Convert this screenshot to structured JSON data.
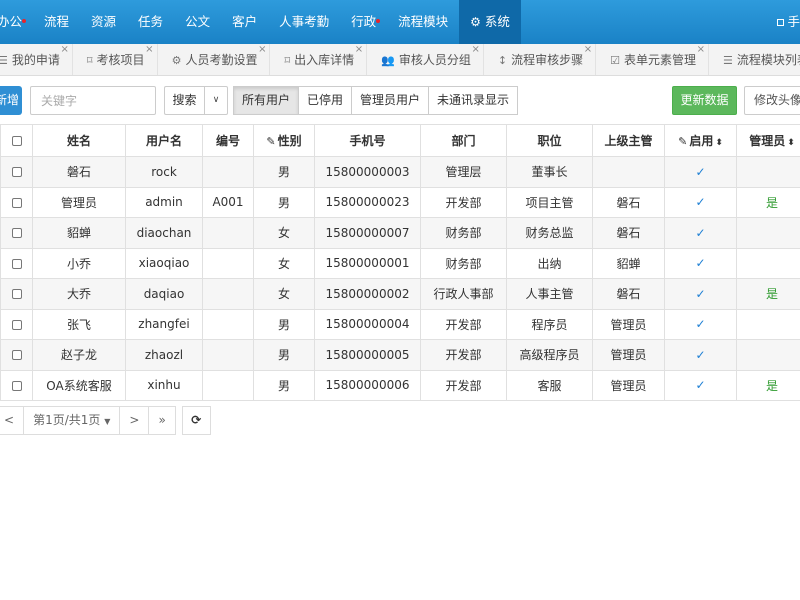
{
  "topnav": {
    "items": [
      {
        "label": "办公",
        "badge": true
      },
      {
        "label": "流程",
        "badge": false
      },
      {
        "label": "资源",
        "badge": false
      },
      {
        "label": "任务",
        "badge": false
      },
      {
        "label": "公文",
        "badge": false
      },
      {
        "label": "客户",
        "badge": false
      },
      {
        "label": "人事考勤",
        "badge": false
      },
      {
        "label": "行政",
        "badge": true
      },
      {
        "label": "流程模块",
        "badge": false
      }
    ],
    "active_label": "系统",
    "right_label": "手"
  },
  "tabs": [
    {
      "label": "我的申请",
      "icon": "list-icon"
    },
    {
      "label": "考核项目",
      "icon": "bookmark-icon"
    },
    {
      "label": "人员考勤设置",
      "icon": "gear-icon"
    },
    {
      "label": "出入库详情",
      "icon": "bookmark-icon"
    },
    {
      "label": "审核人员分组",
      "icon": "users-icon"
    },
    {
      "label": "流程审核步骤",
      "icon": "step-icon"
    },
    {
      "label": "表单元素管理",
      "icon": "checkbox-icon"
    },
    {
      "label": "流程模块列表",
      "icon": "list-icon"
    }
  ],
  "toolbar": {
    "add_label": "新增",
    "keyword_placeholder": "关键字",
    "search_label": "搜索",
    "filters": [
      "所有用户",
      "已停用",
      "管理员用户",
      "未通讯录显示"
    ],
    "refresh_label": "更新数据",
    "avatar_label": "修改头像"
  },
  "table": {
    "headers": {
      "name": "姓名",
      "username": "用户名",
      "number": "编号",
      "gender": "性别",
      "phone": "手机号",
      "dept": "部门",
      "position": "职位",
      "supervisor": "上级主管",
      "enabled": "启用",
      "admin": "管理员"
    },
    "rows": [
      {
        "name": "磐石",
        "username": "rock",
        "number": "",
        "gender": "男",
        "phone": "15800000003",
        "dept": "管理层",
        "position": "董事长",
        "supervisor": "",
        "enabled": "✓",
        "admin": ""
      },
      {
        "name": "管理员",
        "username": "admin",
        "number": "A001",
        "gender": "男",
        "phone": "15800000023",
        "dept": "开发部",
        "position": "项目主管",
        "supervisor": "磐石",
        "enabled": "✓",
        "admin": "是"
      },
      {
        "name": "貂蝉",
        "username": "diaochan",
        "number": "",
        "gender": "女",
        "phone": "15800000007",
        "dept": "财务部",
        "position": "财务总监",
        "supervisor": "磐石",
        "enabled": "✓",
        "admin": ""
      },
      {
        "name": "小乔",
        "username": "xiaoqiao",
        "number": "",
        "gender": "女",
        "phone": "15800000001",
        "dept": "财务部",
        "position": "出纳",
        "supervisor": "貂蝉",
        "enabled": "✓",
        "admin": ""
      },
      {
        "name": "大乔",
        "username": "daqiao",
        "number": "",
        "gender": "女",
        "phone": "15800000002",
        "dept": "行政人事部",
        "position": "人事主管",
        "supervisor": "磐石",
        "enabled": "✓",
        "admin": "是"
      },
      {
        "name": "张飞",
        "username": "zhangfei",
        "number": "",
        "gender": "男",
        "phone": "15800000004",
        "dept": "开发部",
        "position": "程序员",
        "supervisor": "管理员",
        "enabled": "✓",
        "admin": ""
      },
      {
        "name": "赵子龙",
        "username": "zhaozl",
        "number": "",
        "gender": "男",
        "phone": "15800000005",
        "dept": "开发部",
        "position": "高级程序员",
        "supervisor": "管理员",
        "enabled": "✓",
        "admin": ""
      },
      {
        "name": "OA系统客服",
        "username": "xinhu",
        "number": "",
        "gender": "男",
        "phone": "15800000006",
        "dept": "开发部",
        "position": "客服",
        "supervisor": "管理员",
        "enabled": "✓",
        "admin": "是"
      }
    ]
  },
  "pager": {
    "prev": "<",
    "page_label": "第1页/共1页",
    "next": ">",
    "last": "»"
  },
  "colors": {
    "nav_bg": "#1a82c6",
    "nav_active": "#0f69a8",
    "primary": "#2f8fd4",
    "success": "#5cb85c",
    "tick": "#1d7fd4",
    "yes": "#2e9a2e"
  }
}
